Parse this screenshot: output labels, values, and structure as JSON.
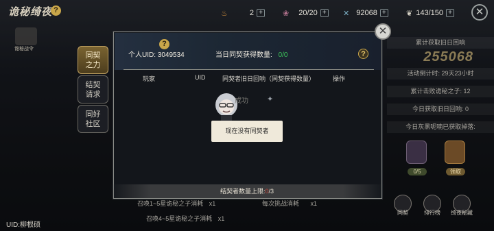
{
  "header": {
    "title": "诡秘绮夜",
    "war_order_label": "诡秘战令",
    "resources": [
      {
        "value": "2",
        "icon": "candle-icon"
      },
      {
        "value": "20/20",
        "icon": "rose-icon"
      },
      {
        "value": "92068",
        "icon": "crystal-icon"
      },
      {
        "value": "143/150",
        "icon": "feather-icon"
      }
    ]
  },
  "right_panel": {
    "total_label": "累计获取旧日回响",
    "total_value": "255068",
    "countdown": "活动倒计时: 29天23小时",
    "defeated": "累计击败诡秘之子: 12",
    "today_echo": "今日获取旧日回响: 0",
    "today_drop": "今日灰黑呢喃已获取掉落:",
    "reward_count": "0/5",
    "reward_button": "领取",
    "nav": [
      "同契",
      "排行榜",
      "绮夜秘藏"
    ]
  },
  "left_rows": [
    {
      "text": "召唤1~5星诡秘之子消耗",
      "count": "x1"
    },
    {
      "text": "召唤4~5星诡秘之子消耗",
      "count": "x1"
    }
  ],
  "left_mid_text": {
    "text": "每次挑战消耗",
    "count": "x1"
  },
  "uid_footer": "UID:柳根硕",
  "modal": {
    "tabs": [
      {
        "label1": "同契",
        "label2": "之力"
      },
      {
        "label1": "结契",
        "label2": "请求"
      },
      {
        "label1": "同好",
        "label2": "社区"
      }
    ],
    "personal_uid": "个人UID: 3049534",
    "today_count_label": "当日同契获得数量:",
    "today_count_value": "0/0",
    "columns": [
      "玩家",
      "UID",
      "同契者旧日回响（同契获得数量）",
      "操作"
    ],
    "success_text": "成功",
    "toast": "现在没有同契者",
    "limit_label": "结契者数量上限:",
    "limit_current": "0",
    "limit_max": "/3"
  },
  "colors": {
    "accent_gold": "#c5a563",
    "positive_green": "#3cc35a",
    "warning_red": "#d24a3d"
  }
}
